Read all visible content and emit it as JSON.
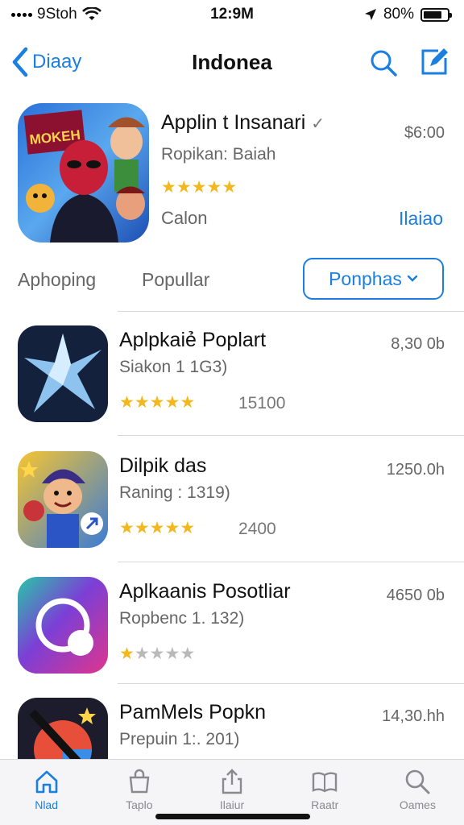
{
  "status": {
    "carrier": "9Stoh",
    "time": "12:9M",
    "battery": "80%",
    "battery_level": 0.8
  },
  "nav": {
    "back_label": "Diaay",
    "title": "Indonea"
  },
  "featured": {
    "title": "Applin t Insanari",
    "title_suffix": "✓",
    "subtitle": "Ropikan: Baiah",
    "price": "$6:00",
    "category": "Calon",
    "link": "Ilaiao",
    "rating": 4.5,
    "icon_text": "MOKEH"
  },
  "segments": {
    "tab1": "Aphoping",
    "tab2": "Popullar",
    "button": "Ponphas"
  },
  "apps": [
    {
      "name": "Aplpkaiẻ Poplart",
      "sub": "Siakon 1 1G3)",
      "price": "8,30 0b",
      "rating": 4.5,
      "count": "15100",
      "icon": "star-app-icon"
    },
    {
      "name": "Dilpik das",
      "sub": "Raning : 1319)",
      "price": "1250.0h",
      "rating": 4.5,
      "count": "2400",
      "icon": "cartoon-app-icon"
    },
    {
      "name": "Aplkaanis Posotliar",
      "sub": "Ropbenc 1. 132)",
      "price": "4650 0b",
      "rating": 1,
      "count": "",
      "icon": "circle-app-icon"
    },
    {
      "name": "PamMels Popkn",
      "sub": "Prepuin 1:. 201)",
      "price": "14,30.hh",
      "rating": 0,
      "count": "",
      "icon": "arrow-app-icon"
    }
  ],
  "tabs": [
    {
      "label": "Nlad",
      "icon": "home-icon",
      "active": true
    },
    {
      "label": "Taplo",
      "icon": "bag-icon",
      "active": false
    },
    {
      "label": "Ilaiur",
      "icon": "share-icon",
      "active": false
    },
    {
      "label": "Raatr",
      "icon": "book-icon",
      "active": false
    },
    {
      "label": "Oames",
      "icon": "search-icon",
      "active": false
    }
  ],
  "colors": {
    "accent": "#1a7fe0",
    "star": "#f3b81d",
    "star_off": "#b9b9b9",
    "divider": "#d8d8d8"
  }
}
